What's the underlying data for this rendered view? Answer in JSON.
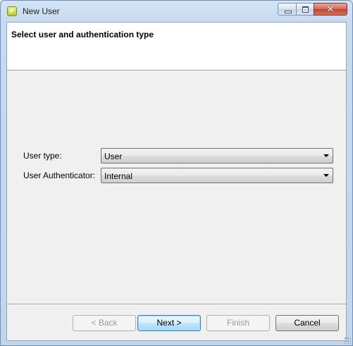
{
  "window": {
    "title": "New User",
    "icon": "app-logo-icon"
  },
  "banner": {
    "title": "Select user and authentication type"
  },
  "form": {
    "user_type": {
      "label": "User type:",
      "value": "User"
    },
    "authenticator": {
      "label": "User Authenticator:",
      "value": "Internal"
    }
  },
  "buttons": {
    "back": "< Back",
    "next": "Next >",
    "finish": "Finish",
    "cancel": "Cancel"
  },
  "colors": {
    "close_button": "#c2422f",
    "default_button_border": "#3c7fb1"
  }
}
